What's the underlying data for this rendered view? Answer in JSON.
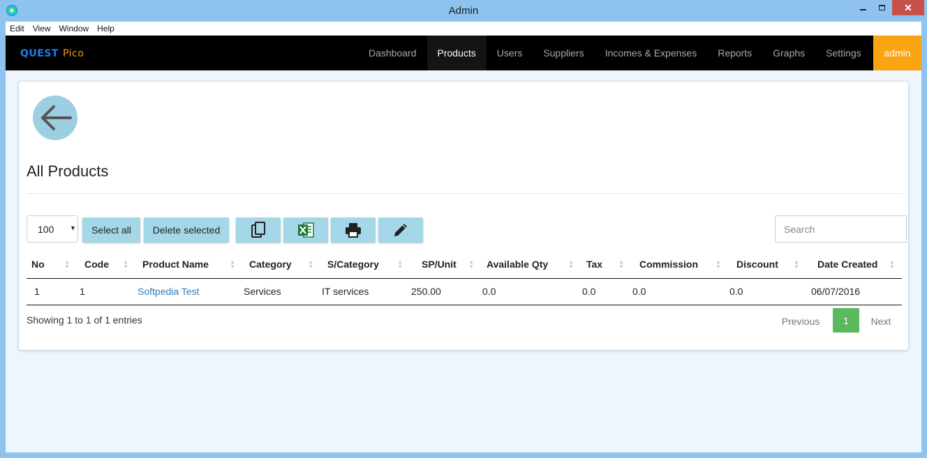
{
  "window": {
    "title": "Admin",
    "close_glyph": "✕"
  },
  "menu": [
    "Edit",
    "View",
    "Window",
    "Help"
  ],
  "nav": {
    "brand_main": "QUEST",
    "brand_sub": "Pico",
    "items": [
      "Dashboard",
      "Products",
      "Users",
      "Suppliers",
      "Incomes & Expenses",
      "Reports",
      "Graphs",
      "Settings"
    ],
    "active": "Products",
    "user": "admin"
  },
  "page": {
    "title": "All Products"
  },
  "toolbar": {
    "length_value": "100",
    "select_all": "Select all",
    "delete_selected": "Delete selected",
    "search_placeholder": "Search",
    "icons": [
      "copy-icon",
      "excel-icon",
      "print-icon",
      "edit-icon"
    ]
  },
  "table": {
    "headers": [
      "No",
      "Code",
      "Product Name",
      "Category",
      "S/Category",
      "SP/Unit",
      "Available Qty",
      "Tax",
      "Commission",
      "Discount",
      "Date Created"
    ],
    "rows": [
      [
        "1",
        "1",
        "Softpedia Test",
        "Services",
        "IT services",
        "250.00",
        "0.0",
        "0.0",
        "0.0",
        "0.0",
        "06/07/2016"
      ]
    ]
  },
  "footer": {
    "info": "Showing 1 to 1 of 1 entries",
    "previous": "Previous",
    "current_page": "1",
    "next": "Next"
  },
  "colors": {
    "nav_bg": "#000000",
    "admin_bg": "#fba412",
    "accent_button": "#a4d7e7",
    "page_active": "#5cb85c",
    "window_frame": "#8ec3ef"
  }
}
